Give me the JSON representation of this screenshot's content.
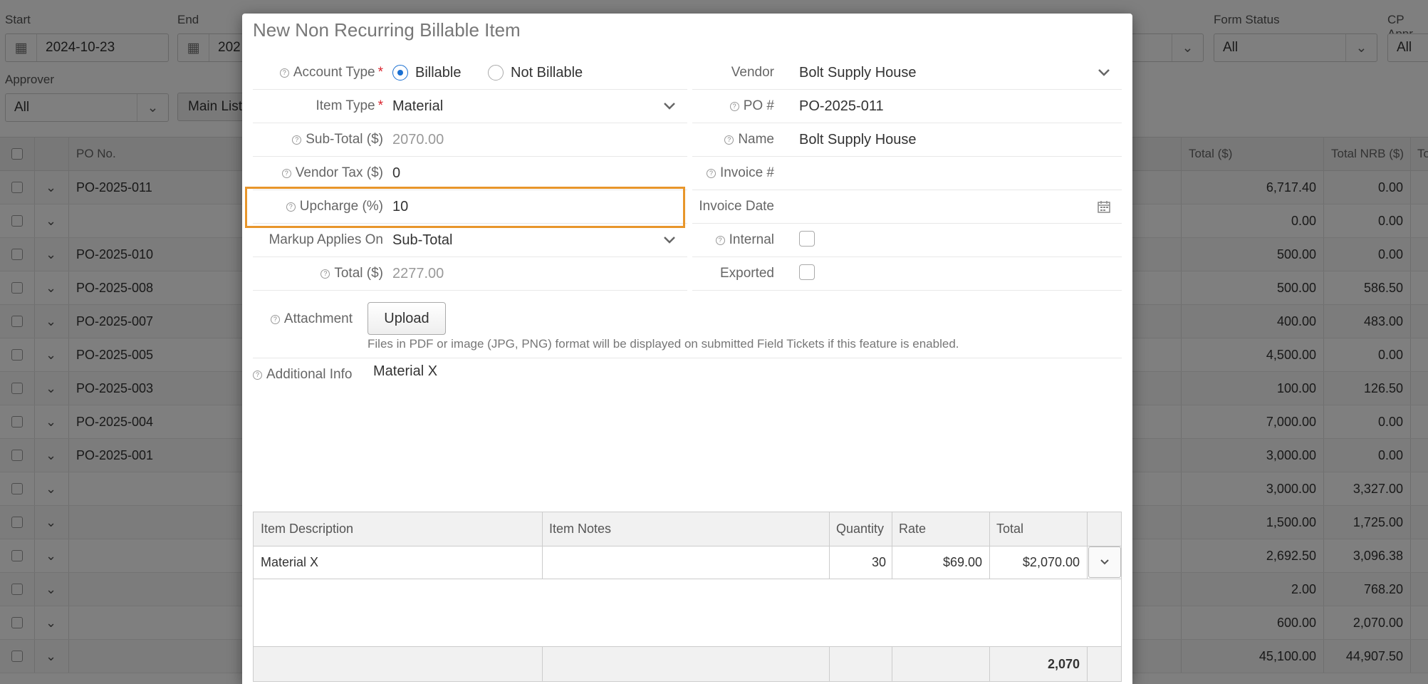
{
  "background": {
    "filters": {
      "start_label": "Start",
      "start_value": "2024-10-23",
      "end_label": "End",
      "end_value": "202",
      "form_status_label": "Form Status",
      "form_status_value": "All",
      "cp_label": "CP Appr",
      "cp_value": "All",
      "approver_label": "Approver",
      "approver_value": "All",
      "main_list_label": "Main List"
    },
    "grid": {
      "headers": {
        "po_no": "PO No.",
        "total": "Total ($)",
        "total_nrb": "Total NRB ($)",
        "more": "To"
      },
      "rows": [
        {
          "po": "PO-2025-011",
          "total": "6,717.40",
          "nrb": "0.00"
        },
        {
          "po": "",
          "total": "0.00",
          "nrb": "0.00"
        },
        {
          "po": "PO-2025-010",
          "total": "500.00",
          "nrb": "0.00"
        },
        {
          "po": "PO-2025-008",
          "total": "500.00",
          "nrb": "586.50"
        },
        {
          "po": "PO-2025-007",
          "total": "400.00",
          "nrb": "483.00"
        },
        {
          "po": "PO-2025-005",
          "total": "4,500.00",
          "nrb": "0.00"
        },
        {
          "po": "PO-2025-003",
          "total": "100.00",
          "nrb": "126.50"
        },
        {
          "po": "PO-2025-004",
          "total": "7,000.00",
          "nrb": "0.00"
        },
        {
          "po": "PO-2025-001",
          "total": "3,000.00",
          "nrb": "0.00"
        },
        {
          "po": "",
          "total": "3,000.00",
          "nrb": "3,327.00"
        },
        {
          "po": "",
          "total": "1,500.00",
          "nrb": "1,725.00"
        },
        {
          "po": "",
          "total": "2,692.50",
          "nrb": "3,096.38"
        },
        {
          "po": "",
          "total": "2.00",
          "nrb": "768.20"
        },
        {
          "po": "",
          "total": "600.00",
          "nrb": "2,070.00"
        },
        {
          "po": "",
          "total": "45,100.00",
          "nrb": "44,907.50"
        }
      ]
    }
  },
  "modal": {
    "title": "New Non Recurring Billable Item",
    "left": {
      "account_type_label": "Account Type",
      "billable_label": "Billable",
      "not_billable_label": "Not Billable",
      "item_type_label": "Item Type",
      "item_type_value": "Material",
      "subtotal_label": "Sub-Total ($)",
      "subtotal_value": "2070.00",
      "vendor_tax_label": "Vendor Tax ($)",
      "vendor_tax_value": "0",
      "upcharge_label": "Upcharge (%)",
      "upcharge_value": "10",
      "markup_label": "Markup Applies On",
      "markup_value": "Sub-Total",
      "total_label": "Total ($)",
      "total_value": "2277.00"
    },
    "right": {
      "vendor_label": "Vendor",
      "vendor_value": "Bolt Supply House",
      "po_label": "PO #",
      "po_value": "PO-2025-011",
      "name_label": "Name",
      "name_value": "Bolt Supply House",
      "invoice_label": "Invoice #",
      "invoice_value": "",
      "invoice_date_label": "Invoice Date",
      "internal_label": "Internal",
      "exported_label": "Exported"
    },
    "attachment_label": "Attachment",
    "upload_label": "Upload",
    "attachment_note": "Files in PDF or image (JPG, PNG) format will be displayed on submitted Field Tickets if this feature is enabled.",
    "additional_info_label": "Additional Info",
    "additional_info_value": "Material X",
    "items_table": {
      "headers": {
        "description": "Item Description",
        "notes": "Item Notes",
        "quantity": "Quantity",
        "rate": "Rate",
        "total": "Total"
      },
      "row": {
        "description": "Material X",
        "notes": "",
        "quantity": "30",
        "rate": "$69.00",
        "total": "$2,070.00"
      },
      "footer_total": "2,070"
    }
  },
  "colors": {
    "highlight": "#e8962b",
    "required": "#d9232d",
    "radio_accent": "#1a6fd1"
  },
  "icons": [
    "calendar-icon",
    "chevron-down-icon",
    "help-icon",
    "checkbox"
  ]
}
